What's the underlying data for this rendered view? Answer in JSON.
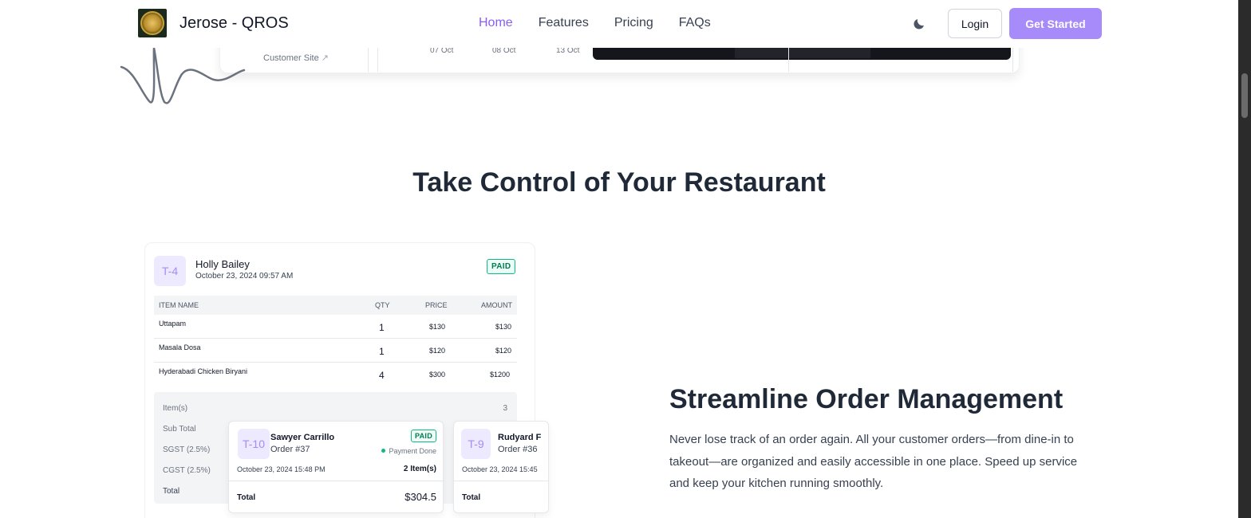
{
  "nav": {
    "brand": "Jerose - QROS",
    "links": [
      "Home",
      "Features",
      "Pricing",
      "FAQs"
    ],
    "login": "Login",
    "get_started": "Get Started",
    "theme_icon": "moon-icon",
    "accent": "#a78bfa"
  },
  "preview": {
    "sidebar_link": "Customer Site",
    "dates": [
      "07 Oct",
      "08 Oct",
      "13 Oct"
    ]
  },
  "section": {
    "title": "Take Control of Your Restaurant"
  },
  "order": {
    "table_badge": "T-4",
    "customer": "Holly Bailey",
    "date": "October 23, 2024 09:57 AM",
    "status": "PAID",
    "columns": [
      "ITEM NAME",
      "QTY",
      "PRICE",
      "AMOUNT"
    ],
    "items": [
      {
        "name": "Uttapam",
        "qty": "1",
        "price": "$130",
        "amount": "$130"
      },
      {
        "name": "Masala Dosa",
        "qty": "1",
        "price": "$120",
        "amount": "$120"
      },
      {
        "name": "Hyderabadi Chicken Biryani",
        "qty": "4",
        "price": "$300",
        "amount": "$1200"
      }
    ],
    "summary": {
      "items_label": "Item(s)",
      "items_value": "3",
      "subtotal_label": "Sub Total",
      "sgst_label": "SGST (2.5%)",
      "cgst_label": "CGST (2.5%)",
      "total_label": "Total"
    }
  },
  "mini_orders": [
    {
      "table_badge": "T-10",
      "customer": "Sawyer Carrillo",
      "order": "Order #37",
      "status": "PAID",
      "payment": "Payment Done",
      "date": "October 23, 2024 15:48 PM",
      "items": "2 Item(s)",
      "total_label": "Total",
      "total": "$304.5"
    },
    {
      "table_badge": "T-9",
      "customer": "Rudyard F",
      "order": "Order #36",
      "date": "October 23, 2024 15:45",
      "total_label": "Total"
    }
  ],
  "feature": {
    "title": "Streamline Order Management",
    "description": "Never lose track of an order again. All your customer orders—from dine-in to takeout—are organized and easily accessible in one place. Speed up service and keep your kitchen running smoothly."
  }
}
